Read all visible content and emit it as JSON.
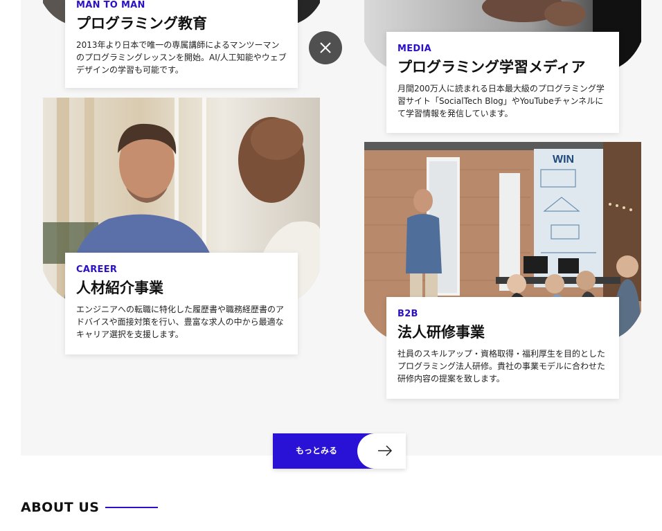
{
  "cards": [
    {
      "tag": "MAN TO MAN",
      "title": "プログラミング教育",
      "desc": "2013年より日本で唯一の専属講師によるマンツーマンのプログラミングレッスンを開始。AI/人工知能やウェブデザインの学習も可能です。"
    },
    {
      "tag": "MEDIA",
      "title": "プログラミング学習メディア",
      "desc": "月間200万人に読まれる日本最大級のプログラミング学習サイト「SocialTech Blog」やYouTubeチャンネルにて学習情報を発信しています。"
    },
    {
      "tag": "CAREER",
      "title": "人材紹介事業",
      "desc": "エンジニアへの転職に特化した履歴書や職務経歴書のアドバイスや面接対策を行い、豊富な求人の中から最適なキャリア選択を支援します。"
    },
    {
      "tag": "B2B",
      "title": "法人研修事業",
      "desc": "社員のスキルアップ・資格取得・福利厚生を目的としたプログラミング法人研修。貴社の事業モデルに合わせた研修内容の提案を致します。"
    }
  ],
  "more_button": {
    "label": "もっとみる"
  },
  "about": {
    "title": "ABOUT US"
  },
  "photo_text": {
    "whiteboard": "WIN"
  },
  "colors": {
    "accent": "#2a11d6",
    "panel": "#f6f6f6",
    "close_bg": "#505050"
  }
}
